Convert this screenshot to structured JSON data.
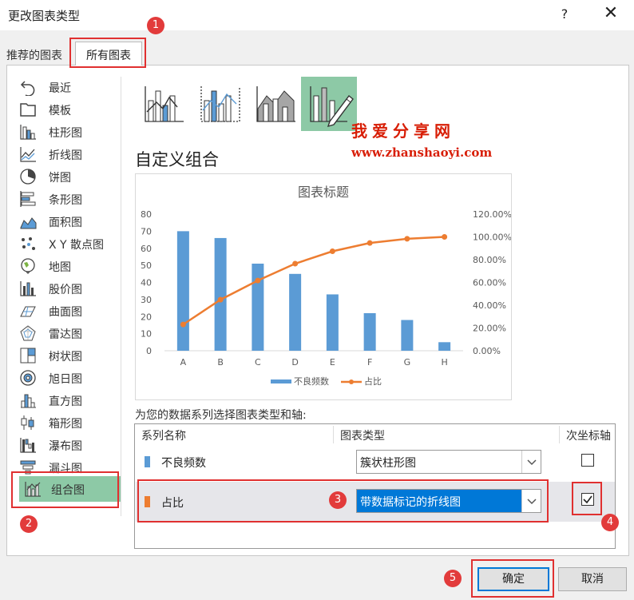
{
  "dialog": {
    "title": "更改图表类型",
    "help": "?",
    "close": "✕"
  },
  "tabs": [
    {
      "label": "推荐的图表"
    },
    {
      "label": "所有图表"
    }
  ],
  "sidebar": {
    "items": [
      {
        "label": "最近",
        "icon": "recent-icon"
      },
      {
        "label": "模板",
        "icon": "template-icon"
      },
      {
        "label": "柱形图",
        "icon": "column-chart-icon"
      },
      {
        "label": "折线图",
        "icon": "line-chart-icon"
      },
      {
        "label": "饼图",
        "icon": "pie-chart-icon"
      },
      {
        "label": "条形图",
        "icon": "bar-chart-icon"
      },
      {
        "label": "面积图",
        "icon": "area-chart-icon"
      },
      {
        "label": "X Y 散点图",
        "icon": "scatter-chart-icon"
      },
      {
        "label": "地图",
        "icon": "map-chart-icon"
      },
      {
        "label": "股价图",
        "icon": "stock-chart-icon"
      },
      {
        "label": "曲面图",
        "icon": "surface-chart-icon"
      },
      {
        "label": "雷达图",
        "icon": "radar-chart-icon"
      },
      {
        "label": "树状图",
        "icon": "treemap-chart-icon"
      },
      {
        "label": "旭日图",
        "icon": "sunburst-chart-icon"
      },
      {
        "label": "直方图",
        "icon": "histogram-chart-icon"
      },
      {
        "label": "箱形图",
        "icon": "box-whisker-chart-icon"
      },
      {
        "label": "瀑布图",
        "icon": "waterfall-chart-icon"
      },
      {
        "label": "漏斗图",
        "icon": "funnel-chart-icon"
      },
      {
        "label": "组合图",
        "icon": "combo-chart-icon"
      }
    ],
    "selected": "组合图"
  },
  "watermark": {
    "line1": "我爱分享网",
    "line2": "www.zhanshaoyi.com"
  },
  "section_heading": "自定义组合",
  "chart_data": {
    "type": "bar",
    "title": "图表标题",
    "categories": [
      "A",
      "B",
      "C",
      "D",
      "E",
      "F",
      "G",
      "H"
    ],
    "series": [
      {
        "name": "不良频数",
        "type": "bar",
        "axis": "primary",
        "color": "#5b9bd5",
        "values": [
          70,
          66,
          51,
          45,
          33,
          22,
          18,
          5
        ]
      },
      {
        "name": "占比",
        "type": "line-markers",
        "axis": "secondary",
        "color": "#ed7d31",
        "values": [
          0.2308,
          0.4484,
          0.6165,
          0.7648,
          0.8736,
          0.9462,
          0.9835,
          1.0
        ]
      }
    ],
    "y_ticks": [
      "0",
      "10",
      "20",
      "30",
      "40",
      "50",
      "60",
      "70",
      "80"
    ],
    "y2_ticks": [
      "0.00%",
      "20.00%",
      "40.00%",
      "60.00%",
      "80.00%",
      "100.00%",
      "120.00%"
    ],
    "ylim": [
      0,
      80
    ],
    "y2lim": [
      0,
      1.2
    ],
    "grid": false,
    "legend": "bottom"
  },
  "series_prompt": "为您的数据系列选择图表类型和轴:",
  "series_table": {
    "headers": {
      "name": "系列名称",
      "type": "图表类型",
      "axis": "次坐标轴"
    },
    "rows": [
      {
        "name": "不良频数",
        "color": "#5b9bd5",
        "chart_type": "簇状柱形图",
        "secondary_axis": false
      },
      {
        "name": "占比",
        "color": "#ed7d31",
        "chart_type": "带数据标记的折线图",
        "secondary_axis": true
      }
    ]
  },
  "buttons": {
    "ok": "确定",
    "cancel": "取消"
  },
  "annotations": [
    "1",
    "2",
    "3",
    "4",
    "5"
  ],
  "accent_color": "#e03030"
}
